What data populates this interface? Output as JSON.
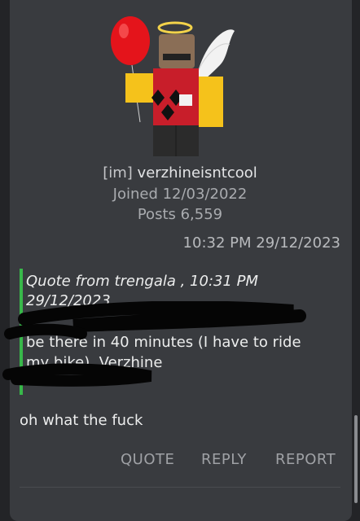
{
  "user": {
    "prefix": "[im]",
    "name": "verzhineisntcool",
    "joined": "Joined 12/03/2022",
    "posts": "Posts 6,559"
  },
  "post": {
    "timestamp": "10:32 PM 29/12/2023",
    "quote_header": "Quote from trengala , 10:31 PM 29/12/2023",
    "quote_body": "be there in 40 minutes (I have to ride my bike), Verzhine",
    "reply_text": "oh what the fuck"
  },
  "actions": {
    "quote": "QUOTE",
    "reply": "REPLY",
    "report": "REPORT"
  },
  "colors": {
    "background": "#232427",
    "card": "#393b3f",
    "quote_bar": "#38b84a",
    "action_text": "#9fa1a5"
  }
}
